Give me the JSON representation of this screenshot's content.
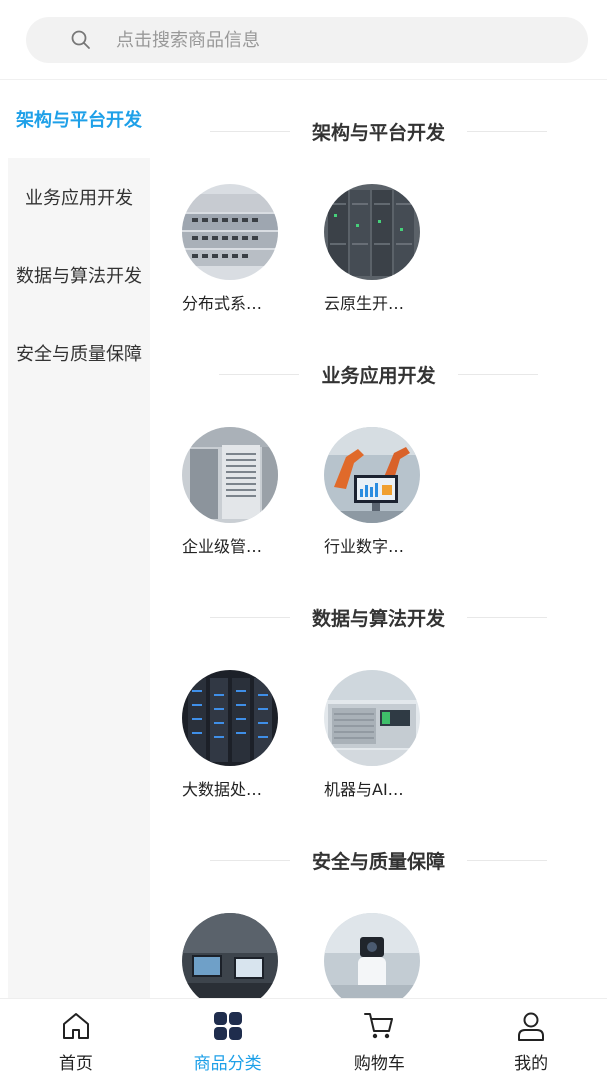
{
  "search": {
    "placeholder": "点击搜索商品信息"
  },
  "sidebar": {
    "items": [
      {
        "label": "架构与平台开发",
        "active": true
      },
      {
        "label": "业务应用开发",
        "active": false
      },
      {
        "label": "数据与算法开发",
        "active": false
      },
      {
        "label": "安全与质量保障",
        "active": false
      }
    ]
  },
  "sections": [
    {
      "title": "架构与平台开发",
      "products": [
        {
          "name": "分布式系…",
          "image": "network-switch-rack"
        },
        {
          "name": "云原生开…",
          "image": "server-cabinets"
        }
      ]
    },
    {
      "title": "业务应用开发",
      "products": [
        {
          "name": "企业级管…",
          "image": "server-room-cabinet"
        },
        {
          "name": "行业数字…",
          "image": "robot-arm-monitor"
        }
      ]
    },
    {
      "title": "数据与算法开发",
      "products": [
        {
          "name": "大数据处…",
          "image": "datacenter-racks-blue"
        },
        {
          "name": "机器与AI…",
          "image": "lab-equipment"
        }
      ]
    },
    {
      "title": "安全与质量保障",
      "products": [
        {
          "name": "",
          "image": "monitoring-workstations"
        },
        {
          "name": "",
          "image": "security-camera-device"
        }
      ]
    }
  ],
  "tabbar": {
    "items": [
      {
        "label": "首页",
        "icon": "home-icon",
        "active": false
      },
      {
        "label": "商品分类",
        "icon": "category-icon",
        "active": true
      },
      {
        "label": "购物车",
        "icon": "cart-icon",
        "active": false
      },
      {
        "label": "我的",
        "icon": "user-icon",
        "active": false
      }
    ]
  },
  "colors": {
    "accent": "#1ea0e8",
    "sidebar_bg": "#f6f6f6",
    "search_bg": "#f2f2f2",
    "category_icon": "#1f2d4d"
  }
}
